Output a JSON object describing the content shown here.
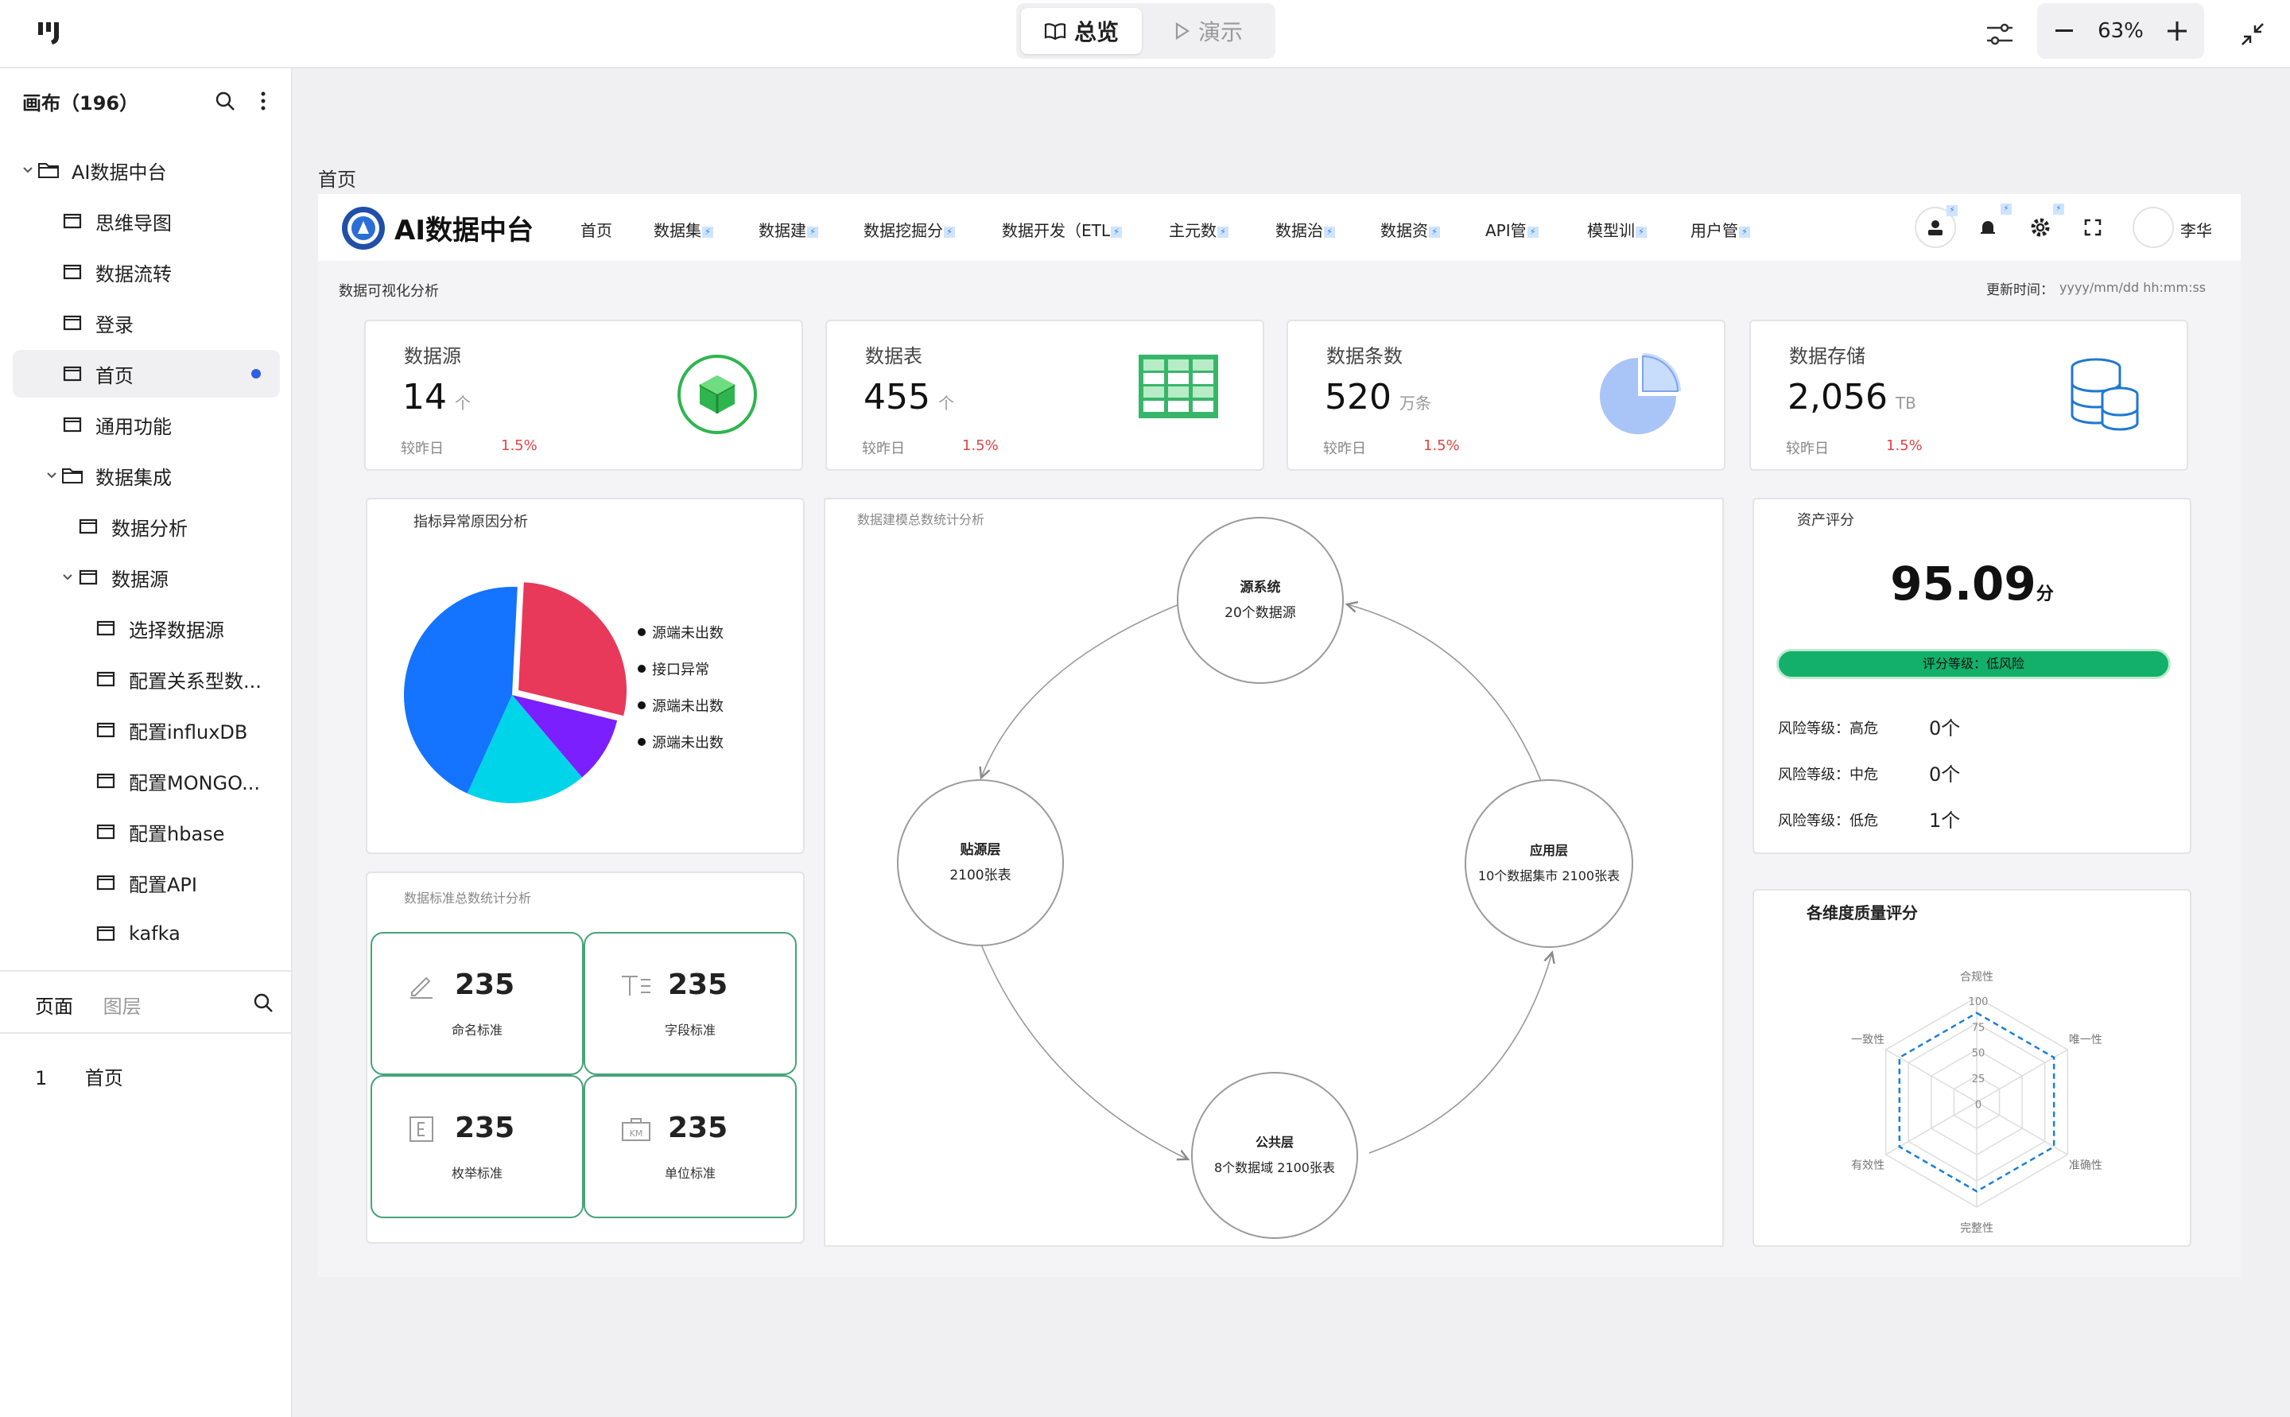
{
  "topbar": {
    "tabs": [
      {
        "label": "总览",
        "active": true
      },
      {
        "label": "演示",
        "active": false
      }
    ],
    "zoom": "63%"
  },
  "sidebar": {
    "title": "画布（196）",
    "tree": [
      {
        "label": "AI数据中台",
        "type": "folder",
        "depth": 0,
        "expanded": true
      },
      {
        "label": "思维导图",
        "type": "page",
        "depth": 1
      },
      {
        "label": "数据流转",
        "type": "page",
        "depth": 1
      },
      {
        "label": "登录",
        "type": "page",
        "depth": 1
      },
      {
        "label": "首页",
        "type": "page",
        "depth": 1,
        "selected": true
      },
      {
        "label": "通用功能",
        "type": "page",
        "depth": 1
      },
      {
        "label": "数据集成",
        "type": "folder",
        "depth": 1,
        "expanded": true
      },
      {
        "label": "数据分析",
        "type": "page",
        "depth": 2
      },
      {
        "label": "数据源",
        "type": "page",
        "depth": 2,
        "expanded": true
      },
      {
        "label": "选择数据源",
        "type": "page",
        "depth": 3
      },
      {
        "label": "配置关系型数...",
        "type": "page",
        "depth": 3
      },
      {
        "label": "配置influxDB",
        "type": "page",
        "depth": 3
      },
      {
        "label": "配置MONGO...",
        "type": "page",
        "depth": 3
      },
      {
        "label": "配置hbase",
        "type": "page",
        "depth": 3
      },
      {
        "label": "配置API",
        "type": "page",
        "depth": 3
      },
      {
        "label": "kafka",
        "type": "page",
        "depth": 3
      }
    ],
    "bottom_tabs": [
      "页面",
      "图层"
    ],
    "pages": [
      {
        "index": "1",
        "label": "首页"
      }
    ]
  },
  "canvas": {
    "frame_label": "首页",
    "app": {
      "title": "AI数据中台",
      "nav": [
        "首页",
        "数据集",
        "数据建",
        "数据挖掘分",
        "数据开发（ETL",
        "主元数",
        "数据治",
        "数据资",
        "API管",
        "模型训",
        "用户管"
      ],
      "user": "李华",
      "section_title": "数据可视化分析",
      "update_label": "更新时间：",
      "update_value": "yyyy/mm/dd hh:mm:ss",
      "kpis": [
        {
          "title": "数据源",
          "value": "14",
          "unit": "个",
          "foot": "较昨日",
          "pct": "1.5%",
          "icon": "cube-icon"
        },
        {
          "title": "数据表",
          "value": "455",
          "unit": "个",
          "foot": "较昨日",
          "pct": "1.5%",
          "icon": "table-icon"
        },
        {
          "title": "数据条数",
          "value": "520",
          "unit": "万条",
          "foot": "较昨日",
          "pct": "1.5%",
          "icon": "pie-icon"
        },
        {
          "title": "数据存储",
          "value": "2,056",
          "unit": "TB",
          "foot": "较昨日",
          "pct": "1.5%",
          "icon": "database-icon"
        }
      ],
      "pie_panel": {
        "title": "指标异常原因分析",
        "legend": [
          "源端未出数",
          "接口异常",
          "源端未出数",
          "源端未出数"
        ]
      },
      "std_panel": {
        "title": "数据标准总数统计分析",
        "cells": [
          {
            "value": "235",
            "label": "命名标准",
            "icon": "pencil-icon"
          },
          {
            "value": "235",
            "label": "字段标准",
            "icon": "text-field-icon"
          },
          {
            "value": "235",
            "label": "枚举标准",
            "icon": "enum-icon"
          },
          {
            "value": "235",
            "label": "单位标准",
            "icon": "unit-icon"
          }
        ]
      },
      "model_panel": {
        "title": "数据建模总数统计分析",
        "nodes": [
          {
            "name": "源系统",
            "desc": "20个数据源"
          },
          {
            "name": "贴源层",
            "desc": "2100张表"
          },
          {
            "name": "应用层",
            "desc": "10个数据集市  2100张表"
          },
          {
            "name": "公共层",
            "desc": "8个数据域  2100张表"
          }
        ]
      },
      "asset_panel": {
        "title": "资产评分",
        "score": "95.09",
        "score_unit": "分",
        "grade": "评分等级：低风险",
        "risks": [
          {
            "label": "风险等级：高危",
            "value": "0个"
          },
          {
            "label": "风险等级：中危",
            "value": "0个"
          },
          {
            "label": "风险等级：低危",
            "value": "1个"
          }
        ]
      },
      "radar_panel": {
        "title": "各维度质量评分",
        "axes": [
          "合规性",
          "唯一性",
          "准确性",
          "完整性",
          "有效性",
          "一致性"
        ],
        "ticks": [
          "100",
          "75",
          "50",
          "25",
          "0"
        ]
      }
    }
  },
  "chart_data": [
    {
      "type": "pie",
      "title": "指标异常原因分析",
      "categories": [
        "源端未出数",
        "接口异常",
        "源端未出数",
        "源端未出数"
      ],
      "values": [
        28,
        10,
        18,
        44
      ],
      "colors": [
        "#e8395b",
        "#7b1fff",
        "#00d4e8",
        "#1473ff"
      ]
    },
    {
      "type": "radar",
      "title": "各维度质量评分",
      "axes": [
        "合规性",
        "唯一性",
        "准确性",
        "完整性",
        "有效性",
        "一致性"
      ],
      "range": [
        0,
        100
      ],
      "series": [
        {
          "values": [
            85,
            85,
            85,
            85,
            85,
            85
          ]
        }
      ]
    }
  ]
}
